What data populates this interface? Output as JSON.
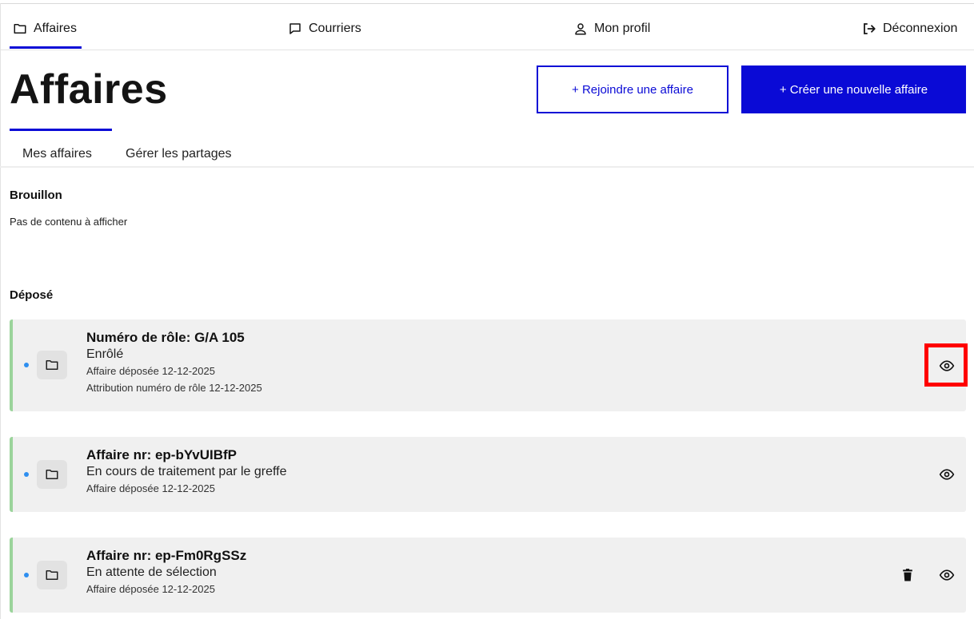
{
  "nav": {
    "affaires": "Affaires",
    "courriers": "Courriers",
    "profil": "Mon profil",
    "deconnexion": "Déconnexion"
  },
  "header": {
    "title": "Affaires",
    "join_button": "+ Rejoindre une affaire",
    "create_button": "+ Créer une nouvelle affaire"
  },
  "tabs": {
    "mes_affaires": "Mes affaires",
    "partages": "Gérer les partages"
  },
  "brouillon": {
    "title": "Brouillon",
    "empty": "Pas de contenu à afficher"
  },
  "depose": {
    "title": "Déposé",
    "cards": [
      {
        "title": "Numéro de rôle: G/A 105",
        "status": "Enrôlé",
        "lines": [
          "Affaire déposée 12-12-2025",
          "Attribution numéro de rôle 12-12-2025"
        ]
      },
      {
        "title": "Affaire nr: ep-bYvUIBfP",
        "status": "En cours de traitement par le greffe",
        "lines": [
          "Affaire déposée 12-12-2025"
        ]
      },
      {
        "title": "Affaire nr: ep-Fm0RgSSz",
        "status": "En attente de sélection",
        "lines": [
          "Affaire déposée 12-12-2025"
        ]
      }
    ]
  },
  "colors": {
    "accent": "#0a0ad6",
    "card_bg": "#f0f0f0",
    "card_border": "#9bd49b",
    "dot": "#2e8ff0",
    "highlight": "#ff0000"
  }
}
